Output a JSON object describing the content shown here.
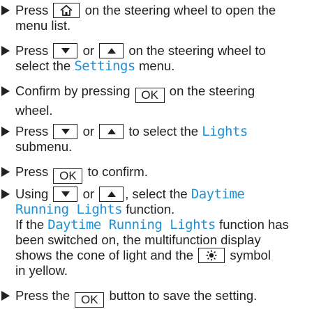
{
  "steps": [
    {
      "a": "Press",
      "key1": "home-icon",
      "b": "on the steering wheel to open the",
      "c": "menu list."
    },
    {
      "a": "Press",
      "or": "or",
      "b": "on the steering wheel to",
      "c": "select the",
      "d": "Settings",
      "e": "menu."
    },
    {
      "a": "Confirm by pressing",
      "ok": "OK",
      "b": "on the steering",
      "c": "wheel."
    },
    {
      "a": "Press",
      "or": "or",
      "b": "to select the",
      "d": "Lights",
      "c": "submenu."
    },
    {
      "a": "Press",
      "ok": "OK",
      "b": "to confirm."
    },
    {
      "a": "Using",
      "or": "or",
      "b": ", select the",
      "d": "Daytime",
      "d2": "Running Lights",
      "e": "function."
    },
    {
      "a": "Press the",
      "ok": "OK",
      "b": "button to save the setting."
    }
  ],
  "note": {
    "a": "If the",
    "d": "Daytime Running Lights",
    "b": "function has",
    "c": "been switched on, the multifunction display",
    "e": "shows the cone of light and the",
    "key": "light-symbol-icon",
    "f": "symbol",
    "g": "in yellow."
  },
  "colors": {
    "display_text": "#1e90d6",
    "text": "#231f20"
  }
}
